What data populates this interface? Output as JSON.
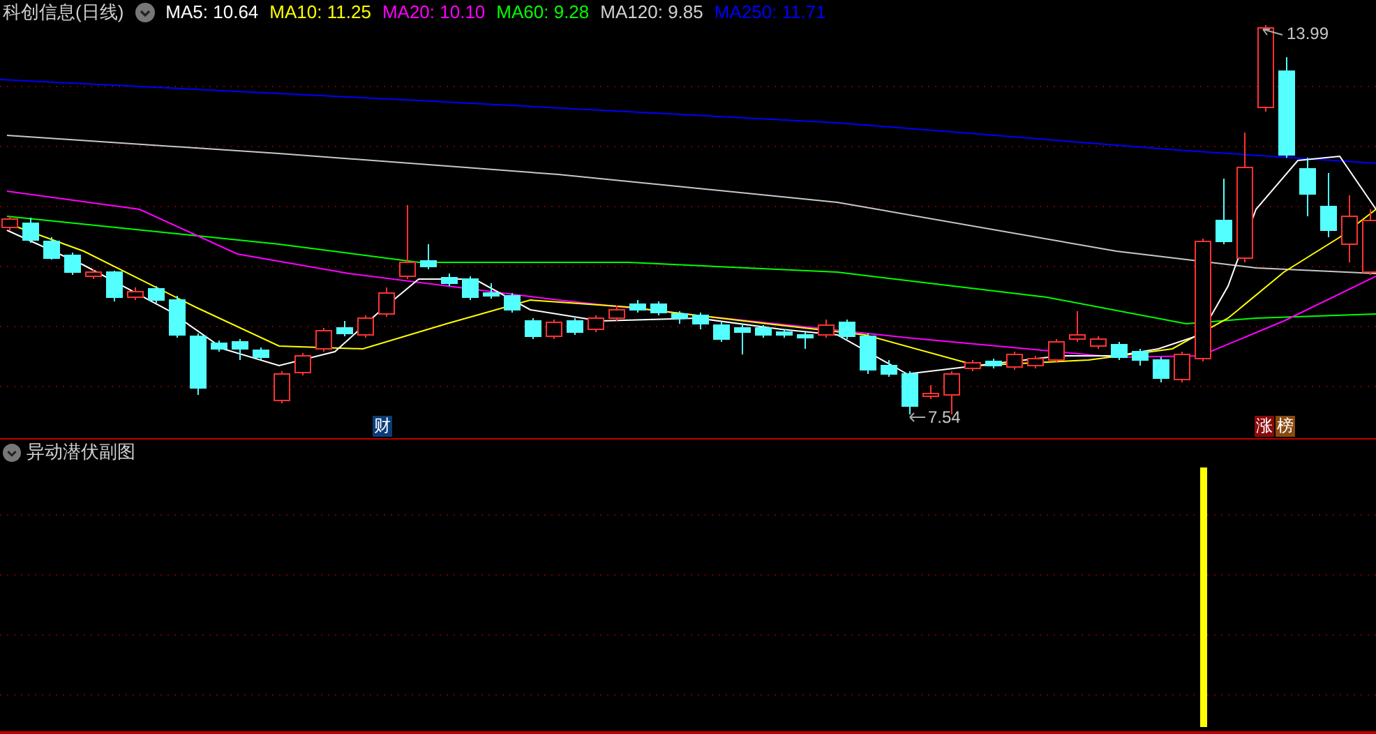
{
  "header": {
    "title": "科创信息(日线)",
    "indicators": [
      {
        "label": "MA5: 10.64",
        "color": "#ffffff"
      },
      {
        "label": "MA10: 11.25",
        "color": "#ffff00"
      },
      {
        "label": "MA20: 10.10",
        "color": "#ff00ff"
      },
      {
        "label": "MA60: 9.28",
        "color": "#00ff00"
      },
      {
        "label": "MA120: 9.85",
        "color": "#d0d0d0"
      },
      {
        "label": "MA250: 11.71",
        "color": "#0000ff"
      }
    ]
  },
  "main_chart": {
    "high_label": "13.99",
    "low_label": "7.54",
    "badges": [
      {
        "text": "财",
        "color": "#0a3c78"
      },
      {
        "text": "涨",
        "color": "#8b0a0a"
      },
      {
        "text": "榜",
        "color": "#8a4a10"
      }
    ]
  },
  "sub_chart": {
    "title": "异动潜伏副图"
  }
}
